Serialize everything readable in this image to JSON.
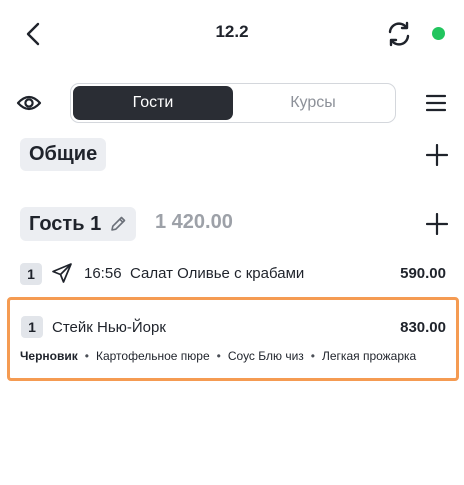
{
  "header": {
    "title": "12.2",
    "status_color": "#22c55e"
  },
  "tabs": [
    {
      "label": "Гости",
      "active": true
    },
    {
      "label": "Курсы",
      "active": false
    }
  ],
  "sections": {
    "general_label": "Общие",
    "guest_label": "Гость 1",
    "guest_total": "1 420.00"
  },
  "items": [
    {
      "qty": "1",
      "time": "16:56",
      "name": "Салат Оливье с крабами",
      "price": "590.00",
      "icon": "send-icon"
    },
    {
      "qty": "1",
      "name": "Стейк Нью-Йорк",
      "price": "830.00",
      "status": "Черновик",
      "modifiers": [
        "Картофельное пюре",
        "Соус Блю чиз",
        "Легкая прожарка"
      ],
      "highlight_color": "#f59b52"
    }
  ],
  "icons": {
    "back": "chevron-left-icon",
    "sync": "sync-icon",
    "eye": "eye-icon",
    "menu": "hamburger-menu-icon",
    "edit": "pencil-icon",
    "add": "plus-icon"
  }
}
